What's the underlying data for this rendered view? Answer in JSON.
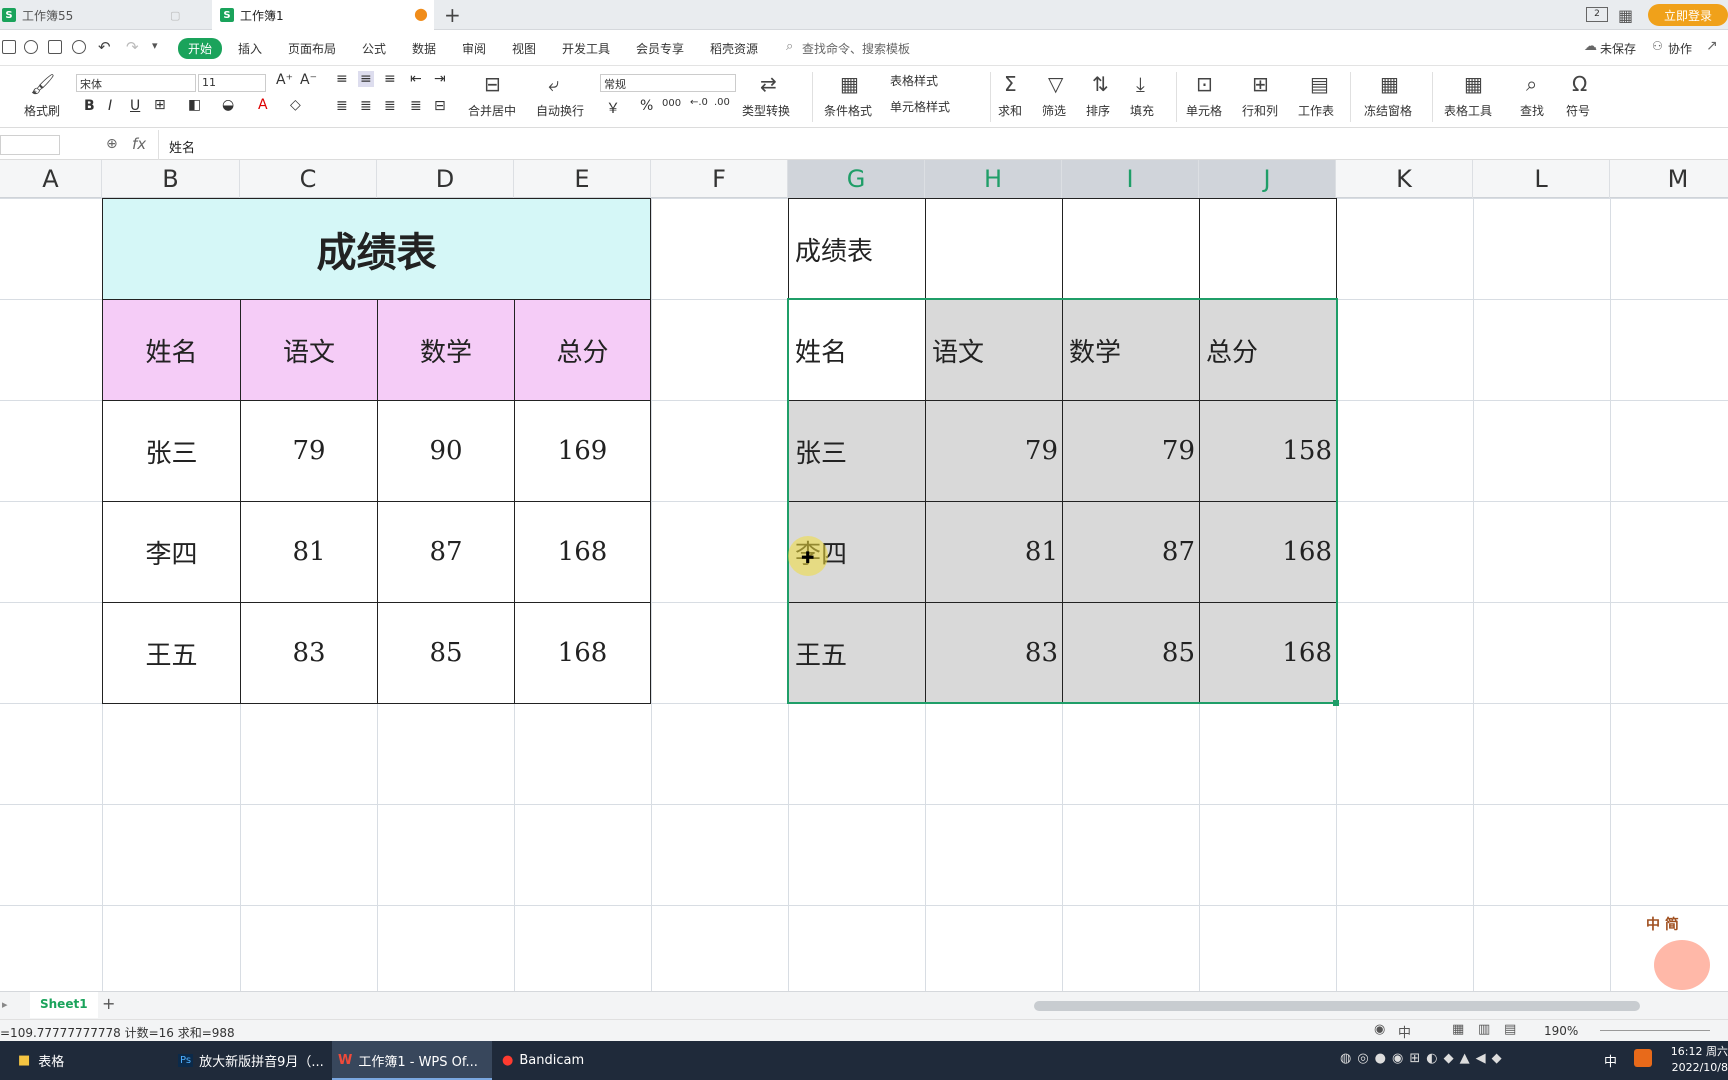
{
  "tabs": [
    {
      "label": "工作簿55",
      "active": false
    },
    {
      "label": "工作簿1",
      "active": true
    }
  ],
  "tab_add_label": "+",
  "login_label": "立即登录",
  "menu": {
    "items": [
      "开始",
      "插入",
      "页面布局",
      "公式",
      "数据",
      "审阅",
      "视图",
      "开发工具",
      "会员专享",
      "稻壳资源"
    ],
    "search_placeholder": "查找命令、搜索模板",
    "unsaved": "未保存",
    "collab": "协作"
  },
  "ribbon": {
    "format_painter": "格式刷",
    "font_name": "宋体",
    "font_size": "11",
    "merge_center": "合并居中",
    "wrap_text": "自动换行",
    "number_format": "常规",
    "type_convert": "类型转换",
    "cond_format": "条件格式",
    "table_style": "表格样式",
    "cell_style": "单元格样式",
    "sum": "求和",
    "filter": "筛选",
    "sort": "排序",
    "fill": "填充",
    "cell": "单元格",
    "row_col": "行和列",
    "worksheet": "工作表",
    "freeze": "冻结窗格",
    "table_tools": "表格工具",
    "find": "查找",
    "symbol": "符号",
    "bold": "B",
    "italic": "I",
    "underline": "U",
    "currency": "￥",
    "percent": "%",
    "thousands": "000"
  },
  "formula": {
    "fx": "fx",
    "content": "姓名"
  },
  "columns": [
    "A",
    "B",
    "C",
    "D",
    "E",
    "F",
    "G",
    "H",
    "I",
    "J",
    "K",
    "L",
    "M"
  ],
  "left_table": {
    "title": "成绩表",
    "headers": [
      "姓名",
      "语文",
      "数学",
      "总分"
    ],
    "rows": [
      [
        "张三",
        "79",
        "90",
        "169"
      ],
      [
        "李四",
        "81",
        "87",
        "168"
      ],
      [
        "王五",
        "83",
        "85",
        "168"
      ]
    ],
    "title_bg": "#d5f7f7",
    "header_bg": "#f5ccf7"
  },
  "right_table": {
    "title": "成绩表",
    "headers": [
      "姓名",
      "语文",
      "数学",
      "总分"
    ],
    "rows": [
      [
        "张三",
        "79",
        "79",
        "158"
      ],
      [
        "李四",
        "81",
        "87",
        "168"
      ],
      [
        "王五",
        "83",
        "85",
        "168"
      ]
    ],
    "selection_color": "#1f9e68",
    "selection_fill": "#d9d9d9"
  },
  "sheet": {
    "name": "Sheet1",
    "add": "+"
  },
  "status": {
    "stats": "=109.77777777778  计数=16  求和=988",
    "zoom": "190%"
  },
  "taskbar": {
    "items": [
      "表格",
      "放大新版拼音9月（...",
      "工作簿1 - WPS Of...",
      "Bandicam"
    ],
    "ime": "中",
    "time": "16:12 周六",
    "date": "2022/10/8"
  },
  "watermark": {
    "text": "中 简"
  }
}
